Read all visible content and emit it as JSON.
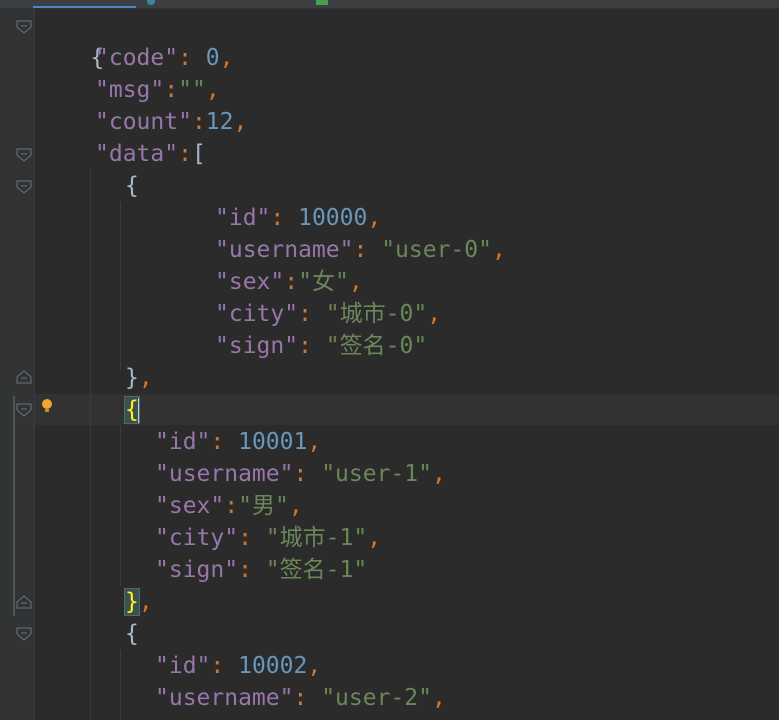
{
  "editor": {
    "lines": {
      "l0": {
        "brace": "{"
      },
      "l1": {
        "key": "\"code\"",
        "colon": ": ",
        "value": "0",
        "comma": ","
      },
      "l2": {
        "key": "\"msg\"",
        "colon": ":",
        "value": "\"\"",
        "comma": ","
      },
      "l3": {
        "key": "\"count\"",
        "colon": ":",
        "value": "12",
        "comma": ","
      },
      "l4": {
        "key": "\"data\"",
        "colon": ":",
        "bracket": "["
      },
      "l5": {
        "brace": "{"
      },
      "l6": {
        "key": "\"id\"",
        "colon": ": ",
        "value": "10000",
        "comma": ","
      },
      "l7": {
        "key": "\"username\"",
        "colon": ": ",
        "value": "\"user-0\"",
        "comma": ","
      },
      "l8": {
        "key": "\"sex\"",
        "colon": ":",
        "value": "\"女\"",
        "comma": ","
      },
      "l9": {
        "key": "\"city\"",
        "colon": ": ",
        "value": "\"城市-0\"",
        "comma": ","
      },
      "l10": {
        "key": "\"sign\"",
        "colon": ": ",
        "value": "\"签名-0\""
      },
      "l11": {
        "brace": "}",
        "comma": ","
      },
      "l12": {
        "brace": "{"
      },
      "l13": {
        "key": "\"id\"",
        "colon": ": ",
        "value": "10001",
        "comma": ","
      },
      "l14": {
        "key": "\"username\"",
        "colon": ": ",
        "value": "\"user-1\"",
        "comma": ","
      },
      "l15": {
        "key": "\"sex\"",
        "colon": ":",
        "value": "\"男\"",
        "comma": ","
      },
      "l16": {
        "key": "\"city\"",
        "colon": ": ",
        "value": "\"城市-1\"",
        "comma": ","
      },
      "l17": {
        "key": "\"sign\"",
        "colon": ": ",
        "value": "\"签名-1\""
      },
      "l18": {
        "brace": "}",
        "comma": ","
      },
      "l19": {
        "brace": "{"
      },
      "l20": {
        "key": "\"id\"",
        "colon": ": ",
        "value": "10002",
        "comma": ","
      },
      "l21": {
        "key": "\"username\"",
        "colon": ": ",
        "value": "\"user-2\"",
        "comma": ","
      }
    }
  },
  "theme": {
    "background": "#2b2b2b",
    "gutter": "#313335",
    "key": "#9876aa",
    "string": "#6a8759",
    "number": "#6897bb",
    "punctuation": "#cc7832",
    "brace_match": "#ffef28"
  },
  "icons": {
    "fold_marker": "fold-marker-icon",
    "intention": "lightbulb-icon"
  }
}
